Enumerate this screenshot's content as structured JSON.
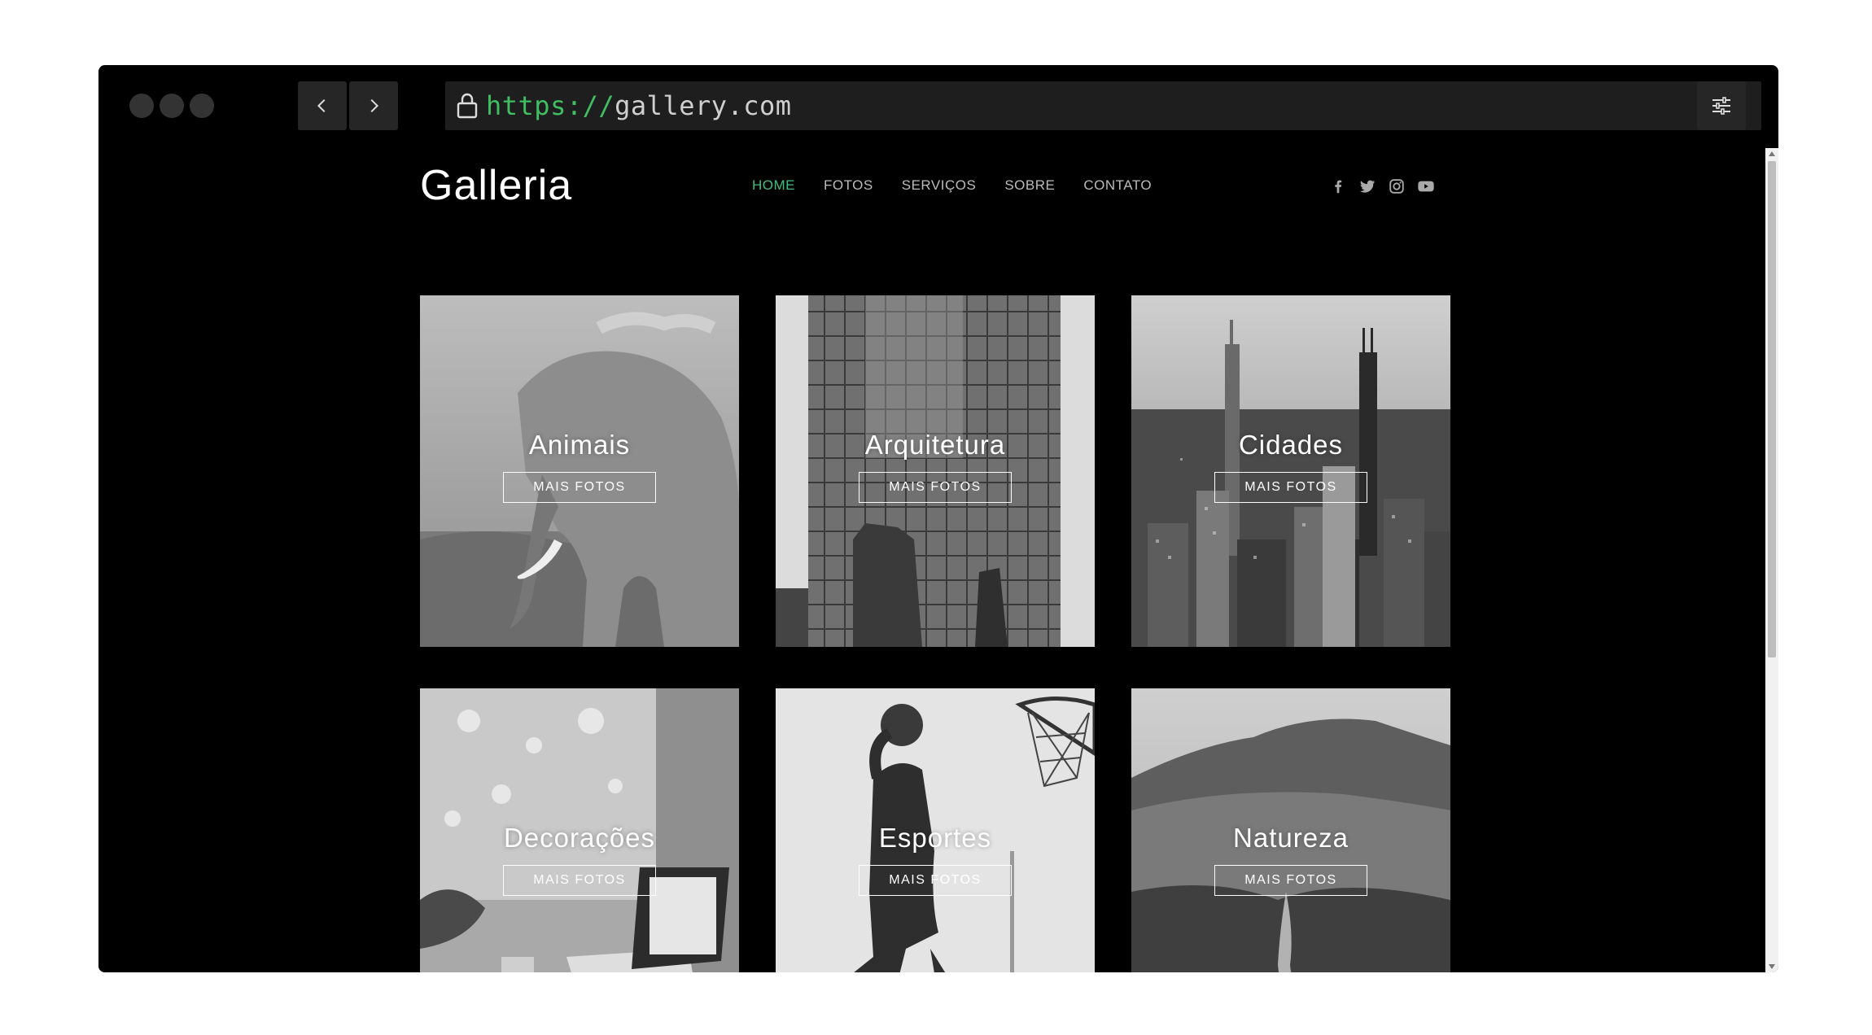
{
  "browser": {
    "url_scheme": "https://",
    "url_host": "gallery.com"
  },
  "site": {
    "logo": "Galleria",
    "menu": [
      {
        "label": "HOME",
        "active": true
      },
      {
        "label": "FOTOS",
        "active": false
      },
      {
        "label": "SERVIÇOS",
        "active": false
      },
      {
        "label": "SOBRE",
        "active": false
      },
      {
        "label": "CONTATO",
        "active": false
      }
    ],
    "socials": [
      "facebook-icon",
      "twitter-icon",
      "instagram-icon",
      "youtube-icon"
    ],
    "accent_color": "#3fbf7f"
  },
  "gallery": {
    "cards": [
      {
        "title": "Animais",
        "button": "MAIS FOTOS"
      },
      {
        "title": "Arquitetura",
        "button": "MAIS FOTOS"
      },
      {
        "title": "Cidades",
        "button": "MAIS FOTOS"
      },
      {
        "title": "Decorações",
        "button": "MAIS FOTOS"
      },
      {
        "title": "Esportes",
        "button": "MAIS FOTOS"
      },
      {
        "title": "Natureza",
        "button": "MAIS FOTOS"
      }
    ]
  }
}
